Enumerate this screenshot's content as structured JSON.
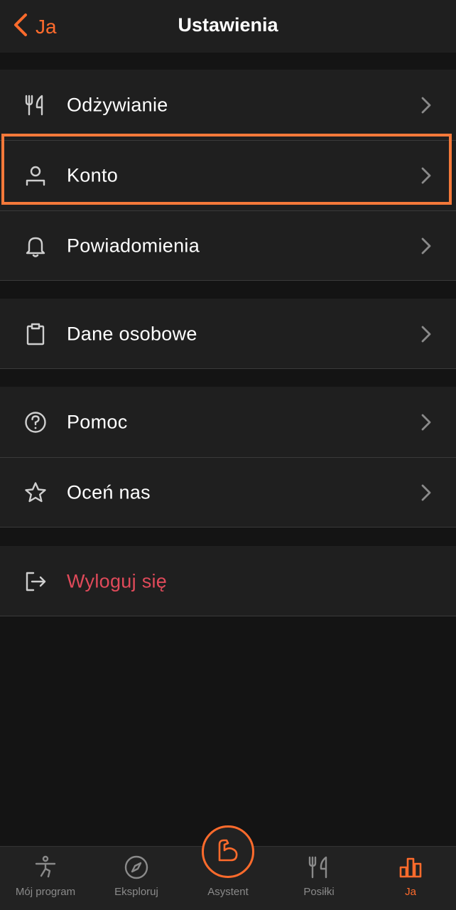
{
  "navbar": {
    "back_label": "Ja",
    "title": "Ustawienia"
  },
  "groups": [
    {
      "items": [
        {
          "label": "Odżywianie",
          "icon": "fork-knife-icon"
        },
        {
          "label": "Konto",
          "icon": "person-icon"
        },
        {
          "label": "Powiadomienia",
          "icon": "bell-icon"
        }
      ]
    },
    {
      "items": [
        {
          "label": "Dane osobowe",
          "icon": "clipboard-icon"
        }
      ]
    },
    {
      "items": [
        {
          "label": "Pomoc",
          "icon": "question-circle-icon"
        },
        {
          "label": "Oceń nas",
          "icon": "star-icon"
        }
      ]
    },
    {
      "items": [
        {
          "label": "Wyloguj się",
          "icon": "logout-icon",
          "color": "#e04a5a"
        }
      ]
    }
  ],
  "tabbar": {
    "tabs": [
      {
        "label": "Mój program",
        "icon": "person-exercise-icon"
      },
      {
        "label": "Eksploruj",
        "icon": "compass-icon"
      },
      {
        "label": "Asystent",
        "icon": "muscle-arm-icon"
      },
      {
        "label": "Posiłki",
        "icon": "fork-knife-icon"
      },
      {
        "label": "Ja",
        "icon": "bar-chart-icon",
        "active": true
      }
    ]
  },
  "colors": {
    "accent": "#ff6b2c",
    "logout": "#e04a5a",
    "highlight": "#f4793a"
  }
}
